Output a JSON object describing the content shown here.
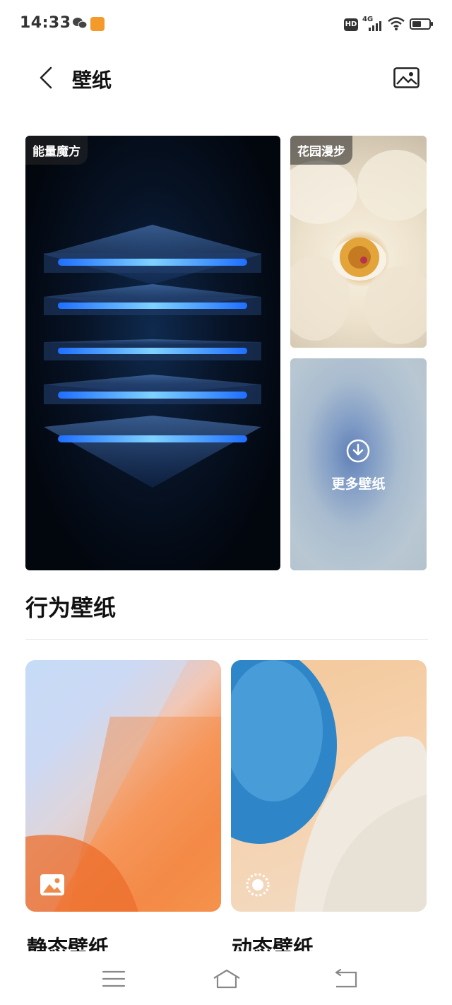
{
  "status_bar": {
    "time": "14:33",
    "network": "4G",
    "hd_label": "HD"
  },
  "header": {
    "title": "壁纸",
    "back_icon": "chevron-left-icon",
    "gallery_icon": "image-icon"
  },
  "featured": [
    {
      "label": "能量魔方"
    },
    {
      "label": "花园漫步"
    }
  ],
  "more": {
    "label": "更多壁纸",
    "icon": "download-icon"
  },
  "section": {
    "title": "行为壁纸"
  },
  "categories": [
    {
      "label": "静态壁纸",
      "icon": "image-icon"
    },
    {
      "label": "动态壁纸",
      "icon": "live-wallpaper-icon"
    }
  ],
  "nav": {
    "menu_icon": "menu-icon",
    "home_icon": "home-icon",
    "back_icon": "back-icon"
  }
}
